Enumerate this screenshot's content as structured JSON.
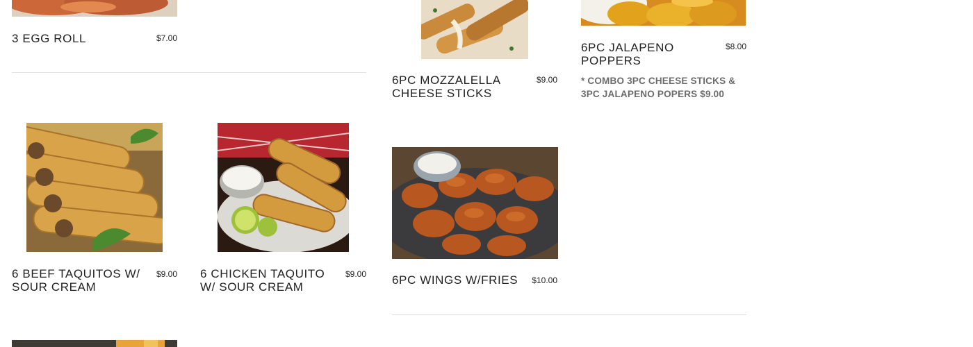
{
  "menu": {
    "items": [
      {
        "id": "egg-roll",
        "name": "3 EGG ROLL",
        "price": "$7.00",
        "photo": "egg-roll-photo"
      },
      {
        "id": "mozzarella",
        "name": "6PC MOZZALELLA\nCHEESE STICKS",
        "price": "$9.00",
        "photo": "mozzarella-sticks-photo"
      },
      {
        "id": "jalapeno",
        "name": "6PC JALAPENO\nPOPPERS",
        "price": "$8.00",
        "photo": "jalapeno-poppers-photo"
      },
      {
        "id": "beef-taquitos",
        "name": "6 BEEF TAQUITOS W/\nSOUR CREAM",
        "price": "$9.00",
        "photo": "beef-taquitos-photo"
      },
      {
        "id": "chicken-taquito",
        "name": "6 CHICKEN TAQUITO\nW/ SOUR CREAM",
        "price": "$9.00",
        "photo": "chicken-taquito-photo"
      },
      {
        "id": "wings",
        "name": "6PC WINGS W/FRIES",
        "price": "$10.00",
        "photo": "wings-photo"
      }
    ],
    "combo_note": "* COMBO 3PC CHEESE STICKS  &\n3PC JALAPENO POPERS $9.00"
  },
  "colors": {
    "text": "#222222",
    "note_text": "#6b6b6b",
    "divider": "#e3e3e3",
    "background": "#ffffff"
  }
}
